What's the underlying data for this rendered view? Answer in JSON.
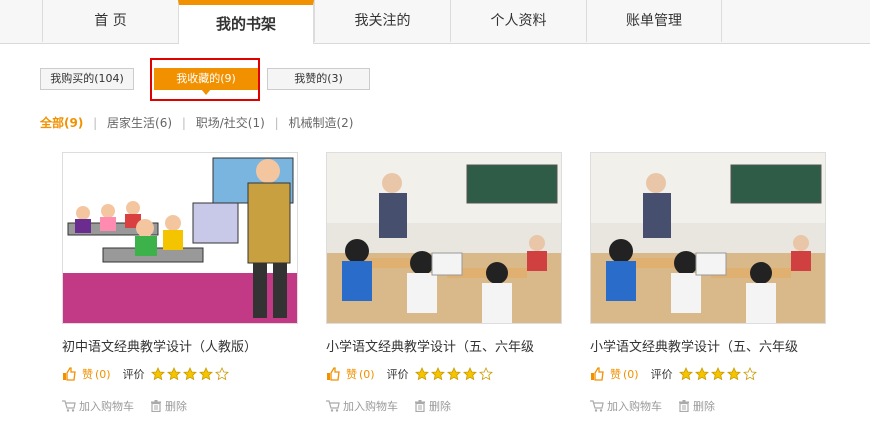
{
  "nav": {
    "tabs": [
      {
        "label": "首  页"
      },
      {
        "label": "我的书架"
      },
      {
        "label": "我关注的"
      },
      {
        "label": "个人资料"
      },
      {
        "label": "账单管理"
      }
    ],
    "active_index": 1,
    "accent_color": "#f29100"
  },
  "subtabs": [
    {
      "label": "我购买的(104)"
    },
    {
      "label": "我收藏的(9)"
    },
    {
      "label": "我赞的(3)"
    }
  ],
  "subtab_active_index": 1,
  "highlight_color": "#e00000",
  "filters": [
    {
      "label": "全部(9)"
    },
    {
      "label": "居家生活(6)"
    },
    {
      "label": "职场/社交(1)"
    },
    {
      "label": "机械制造(2)"
    }
  ],
  "cards": [
    {
      "title": "初中语文经典教学设计（人教版）",
      "like_label": "赞",
      "like_count": "(0)",
      "rating_label": "评价",
      "rating": 4,
      "rating_max": 5,
      "add_cart_label": "加入购物车",
      "delete_label": "删除",
      "image": "cartoon-classroom-illustration"
    },
    {
      "title": "小学语文经典教学设计（五、六年级",
      "like_label": "赞",
      "like_count": "(0)",
      "rating_label": "评价",
      "rating": 4,
      "rating_max": 5,
      "add_cart_label": "加入购物车",
      "delete_label": "删除",
      "image": "classroom-photo"
    },
    {
      "title": "小学语文经典教学设计（五、六年级",
      "like_label": "赞",
      "like_count": "(0)",
      "rating_label": "评价",
      "rating": 4,
      "rating_max": 5,
      "add_cart_label": "加入购物车",
      "delete_label": "删除",
      "image": "classroom-photo"
    }
  ],
  "icons": {
    "like": "thumbs-up-icon",
    "star": "star-icon",
    "cart": "cart-icon",
    "delete": "trash-icon"
  }
}
